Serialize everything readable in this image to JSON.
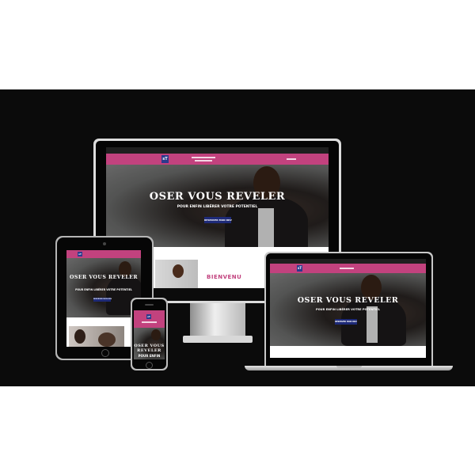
{
  "site": {
    "hero_title": "OSER VOUS REVELER",
    "hero_title_phone_line1": "OSER VOUS",
    "hero_title_phone_line2": "REVELER",
    "hero_subtitle": "POUR ENFIN LIBÉRER VOTRE POTENTIEL",
    "hero_subtitle_phone": "POUR ENFIN",
    "cta_label": "RESERVER MON RDV",
    "welcome_label": "BIENVENU",
    "logo_text": "sT",
    "accent_color": "#c2427e",
    "cta_color": "#1e2a78",
    "background_color": "#0b0b0b"
  },
  "icons": {
    "apple": "apple-logo-icon",
    "home_button": "home-button-icon"
  }
}
